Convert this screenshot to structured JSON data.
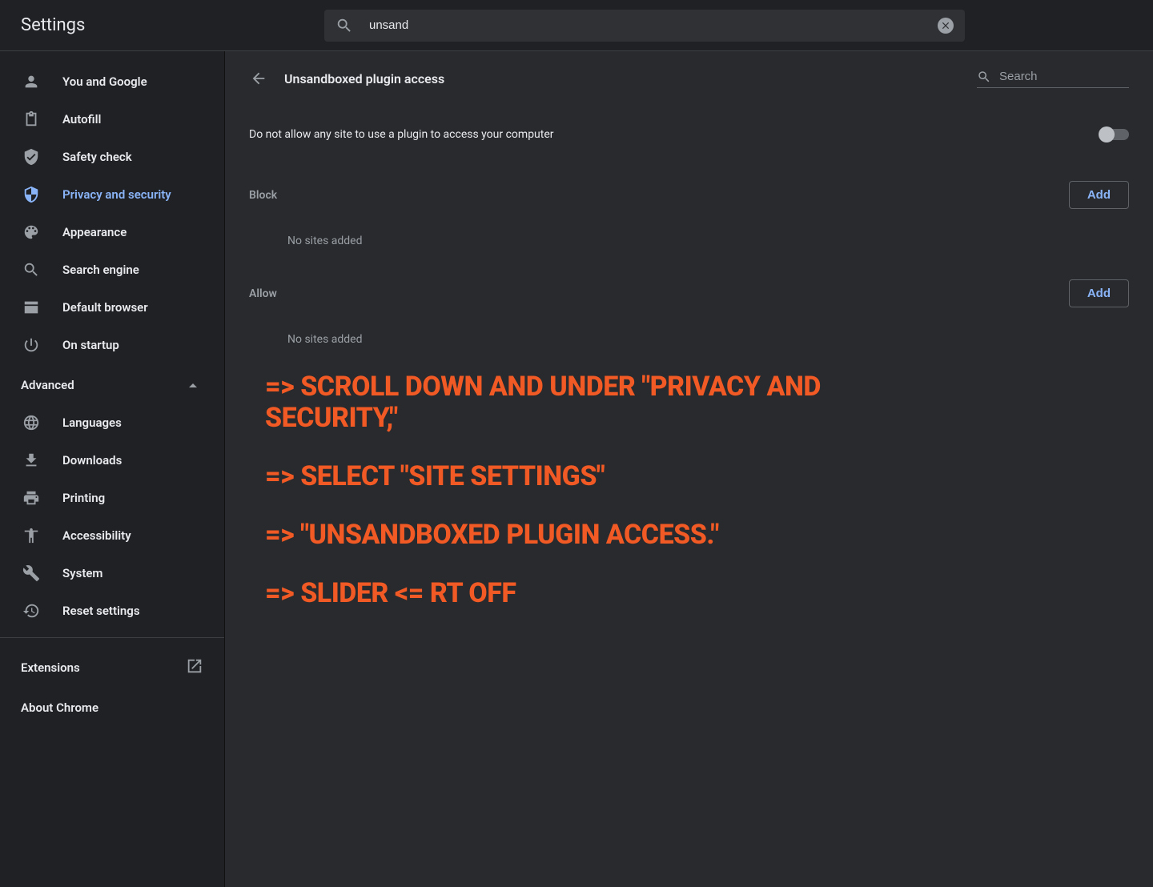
{
  "app": {
    "title": "Settings"
  },
  "search": {
    "value": "unsand"
  },
  "sidebar": {
    "items": [
      {
        "label": "You and Google"
      },
      {
        "label": "Autofill"
      },
      {
        "label": "Safety check"
      },
      {
        "label": "Privacy and security"
      },
      {
        "label": "Appearance"
      },
      {
        "label": "Search engine"
      },
      {
        "label": "Default browser"
      },
      {
        "label": "On startup"
      }
    ],
    "advanced_label": "Advanced",
    "advanced_items": [
      {
        "label": "Languages"
      },
      {
        "label": "Downloads"
      },
      {
        "label": "Printing"
      },
      {
        "label": "Accessibility"
      },
      {
        "label": "System"
      },
      {
        "label": "Reset settings"
      }
    ],
    "extensions_label": "Extensions",
    "about_label": "About Chrome"
  },
  "page": {
    "title": "Unsandboxed plugin access",
    "search_placeholder": "Search",
    "toggle_label": "Do not allow any site to use a plugin to access your computer",
    "block": {
      "title": "Block",
      "add_label": "Add",
      "empty": "No sites added"
    },
    "allow": {
      "title": "Allow",
      "add_label": "Add",
      "empty": "No sites added"
    }
  },
  "overlay": {
    "line1": "=> SCROLL DOWN AND UNDER \"PRIVACY AND SECURITY,\"",
    "line2": "=> SELECT \"SITE SETTINGS\"",
    "line3": "=> \"UNSANDBOXED PLUGIN ACCESS.\"",
    "line4": "=> SLIDER <= RT OFF"
  }
}
